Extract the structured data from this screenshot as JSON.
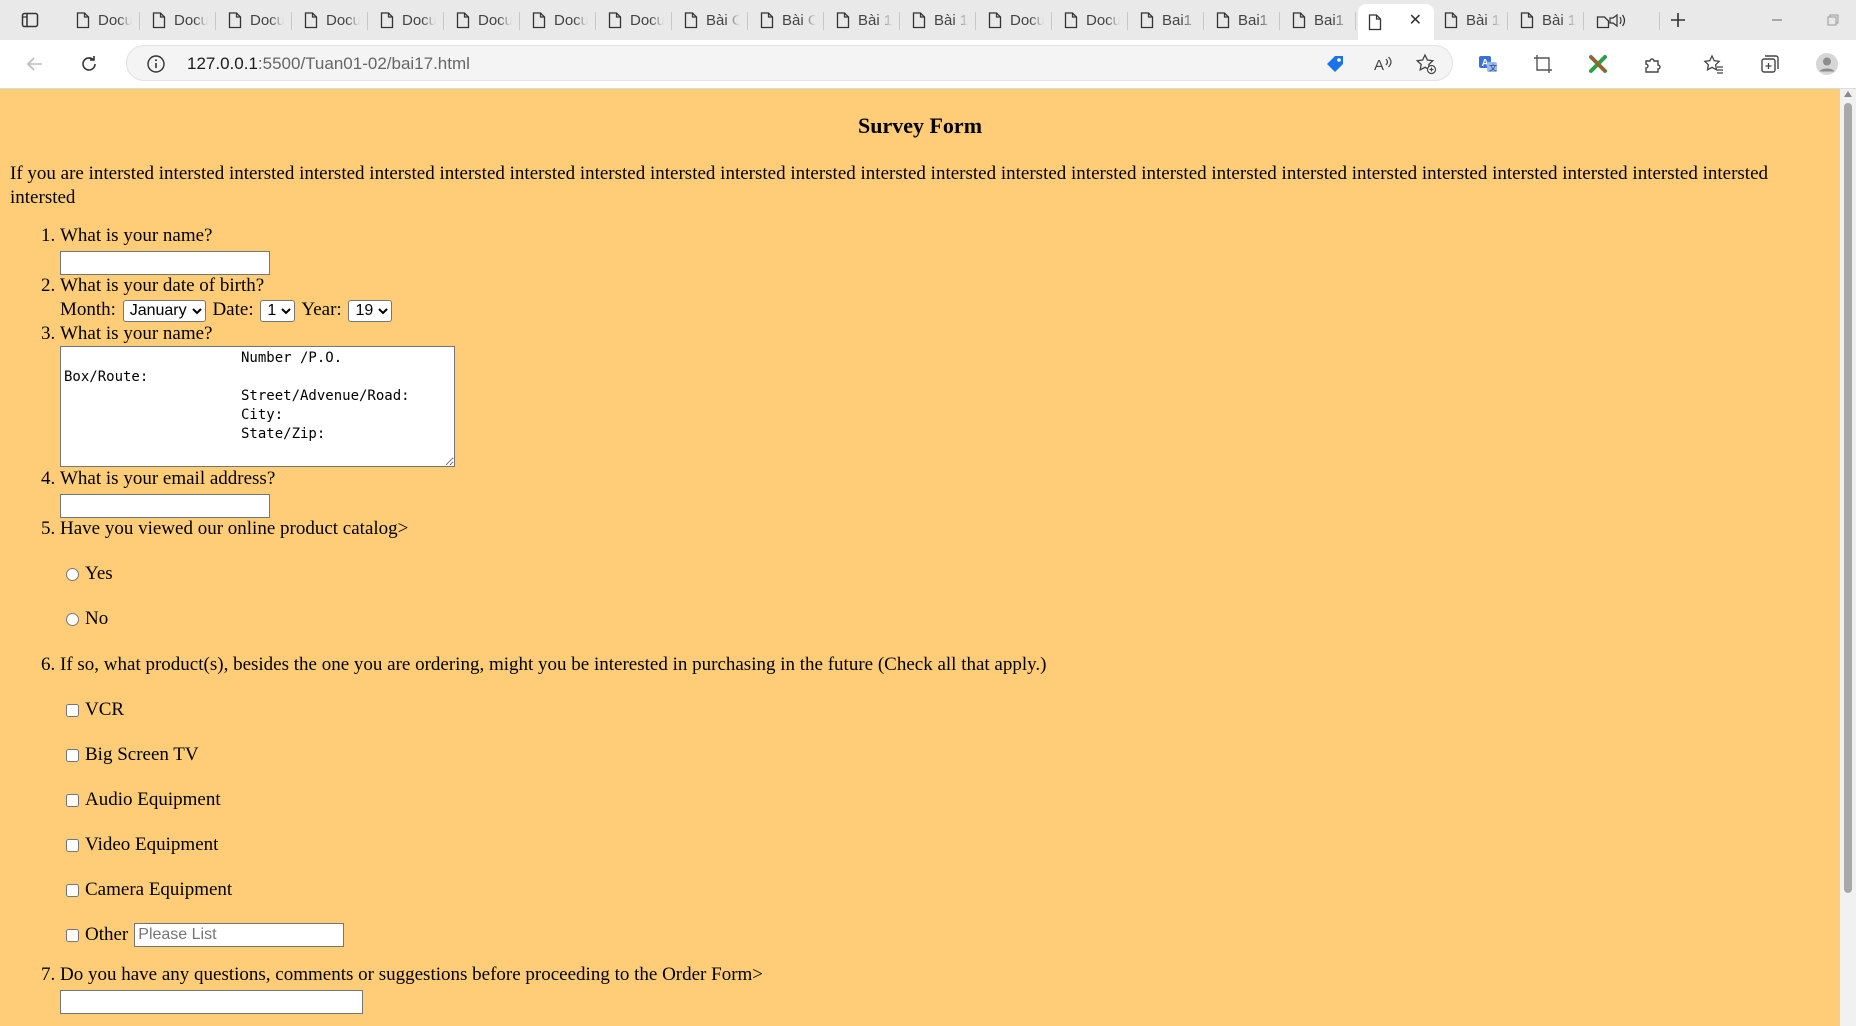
{
  "browser": {
    "tabs": [
      {
        "label": "Docu",
        "icon": "document-icon"
      },
      {
        "label": "Docu",
        "icon": "document-icon"
      },
      {
        "label": "Docu",
        "icon": "document-icon"
      },
      {
        "label": "Docu",
        "icon": "document-icon"
      },
      {
        "label": "Docu",
        "icon": "document-icon"
      },
      {
        "label": "Docu",
        "icon": "document-icon"
      },
      {
        "label": "Docu",
        "icon": "document-icon"
      },
      {
        "label": "Docu",
        "icon": "document-icon"
      },
      {
        "label": "Bài C",
        "icon": "document-icon"
      },
      {
        "label": "Bài C",
        "icon": "document-icon"
      },
      {
        "label": "Bài 1",
        "icon": "document-icon"
      },
      {
        "label": "Bài 1",
        "icon": "document-icon"
      },
      {
        "label": "Docu",
        "icon": "document-icon"
      },
      {
        "label": "Docu",
        "icon": "document-icon"
      },
      {
        "label": "Bai1",
        "icon": "document-icon"
      },
      {
        "label": "Bai1",
        "icon": "document-icon"
      },
      {
        "label": "Bai1",
        "icon": "document-icon"
      },
      {
        "label": "",
        "icon": "document-icon",
        "active": true
      },
      {
        "label": "Bài 1",
        "icon": "document-icon"
      },
      {
        "label": "Bài 1",
        "icon": "document-icon"
      },
      {
        "label": "",
        "icon": "speaker-icon"
      }
    ],
    "address": {
      "host": "127.0.0.1",
      "path": ":5500/Tuan01-02/bai17.html"
    }
  },
  "page": {
    "background": "#ffcc77",
    "title": "Survey Form",
    "intro": "If you are intersted intersted intersted intersted intersted intersted intersted intersted intersted intersted intersted intersted intersted intersted intersted intersted intersted intersted intersted intersted intersted intersted intersted intersted intersted",
    "q1": {
      "label": "What is your name?",
      "value": ""
    },
    "q2": {
      "label": "What is your date of birth?",
      "month_label": "Month:",
      "month_value": "January",
      "date_label": "Date:",
      "date_value": "1",
      "year_label": "Year:",
      "year_value": "19"
    },
    "q3": {
      "label": "What is your name?",
      "textarea": "                     Number /P.O.\nBox/Route:\n                     Street/Advenue/Road:\n                     City:\n                     State/Zip:"
    },
    "q4": {
      "label": "What is your email address?",
      "value": ""
    },
    "q5": {
      "label": "Have you viewed our online product catalog>",
      "options": [
        "Yes",
        "No"
      ]
    },
    "q6": {
      "label": "If so, what product(s), besides the one you are ordering, might you be interested in purchasing in the future (Check all that apply.)",
      "options": [
        "VCR",
        "Big Screen TV",
        "Audio Equipment",
        "Video Equipment",
        "Camera Equipment",
        "Other"
      ],
      "other_placeholder": "Please List"
    },
    "q7": {
      "label": "Do you have any questions, comments or suggestions before proceeding to the Order Form>"
    }
  }
}
